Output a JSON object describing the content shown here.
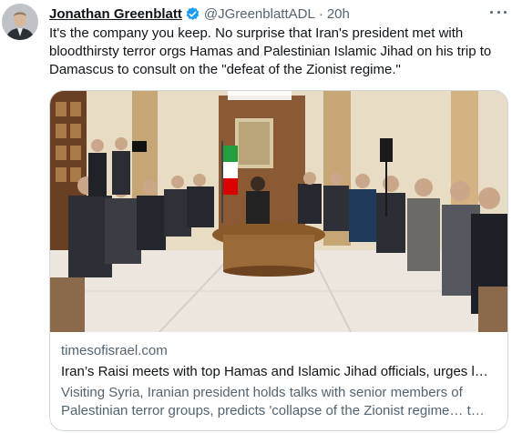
{
  "tweet": {
    "author_name": "Jonathan Greenblatt",
    "handle": "@JGreenblattADL",
    "separator": "·",
    "time": "20h",
    "text": "It's the company you keep. No surprise that Iran's president met with bloodthirsty terror orgs Hamas and Palestinian Islamic Jihad on his trip to Damascus to consult on the \"defeat of the Zionist regime.\""
  },
  "link_card": {
    "domain": "timesofisrael.com",
    "title": "Iran’s Raisi meets with top Hamas and Islamic Jihad officials, urges l…",
    "description": "Visiting Syria, Iranian president holds talks with senior members of Palestinian terror groups, predicts 'collapse of the Zionist regime… t…"
  },
  "colors": {
    "verified_badge": "#1d9bf0",
    "secondary_text": "#536471",
    "card_border": "#cfd9de"
  },
  "icons": {
    "verified": "verified-badge-icon",
    "more": "more-options-icon"
  }
}
